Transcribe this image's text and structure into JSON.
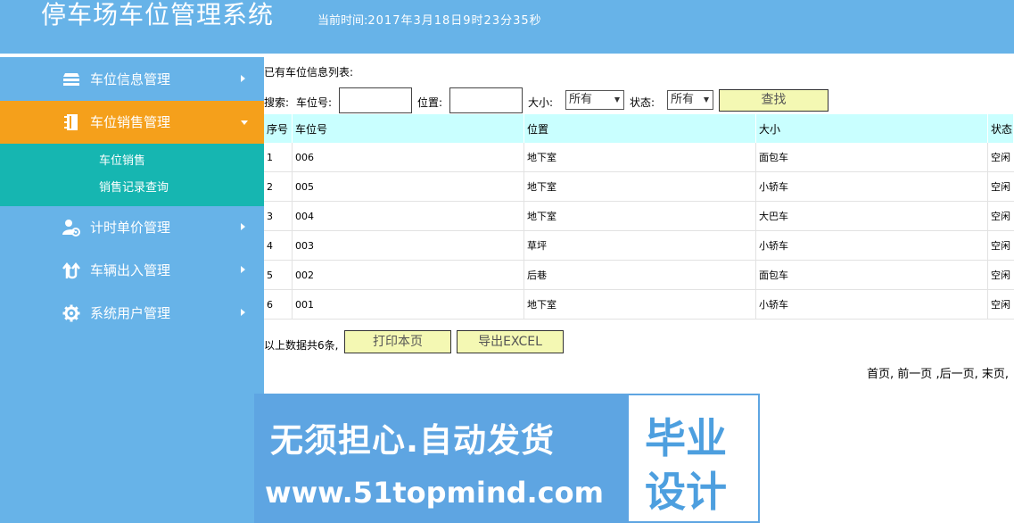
{
  "header": {
    "title": "停车场车位管理系统",
    "time_label": "当前时间:",
    "time_value": "2017年3月18日9时23分35秒"
  },
  "sidebar": {
    "items": [
      {
        "label": "车位信息管理",
        "icon": "stack-icon"
      },
      {
        "label": "车位销售管理",
        "icon": "notebook-icon",
        "active": true,
        "sub": [
          "车位销售",
          "销售记录查询"
        ]
      },
      {
        "label": "计时单价管理",
        "icon": "user-gear-icon"
      },
      {
        "label": "车辆出入管理",
        "icon": "swap-arrows-icon"
      },
      {
        "label": "系统用户管理",
        "icon": "gear-icon"
      }
    ],
    "active_color": "#f5a01b",
    "submenu_color": "#16b6b1",
    "bg_color": "#67b3e8"
  },
  "main": {
    "list_title": "已有车位信息列表:",
    "search": {
      "label": "搜索:",
      "no_label": "车位号:",
      "pos_label": "位置:",
      "size_label": "大小:",
      "size_value": "所有",
      "status_label": "状态:",
      "status_value": "所有",
      "search_button": "查找",
      "no_value": "",
      "pos_value": ""
    },
    "table": {
      "headers": [
        "序号",
        "车位号",
        "位置",
        "大小",
        "状态"
      ],
      "rows": [
        [
          "1",
          "006",
          "地下室",
          "面包车",
          "空闲"
        ],
        [
          "2",
          "005",
          "地下室",
          "小轿车",
          "空闲"
        ],
        [
          "3",
          "004",
          "地下室",
          "大巴车",
          "空闲"
        ],
        [
          "4",
          "003",
          "草坪",
          "小轿车",
          "空闲"
        ],
        [
          "5",
          "002",
          "后巷",
          "面包车",
          "空闲"
        ],
        [
          "6",
          "001",
          "地下室",
          "小轿车",
          "空闲"
        ]
      ]
    },
    "total_text": "以上数据共6条,",
    "print_button": "打印本页",
    "export_button": "导出EXCEL",
    "pager": {
      "first": "首页,",
      "prev": "前一页",
      "next": ",后一页,",
      "last": "末页,"
    }
  },
  "watermark": {
    "line1": "无须担心.自动发货",
    "line2": "www.51topmind.com",
    "box_line1": "毕业",
    "box_line2": "设计"
  }
}
